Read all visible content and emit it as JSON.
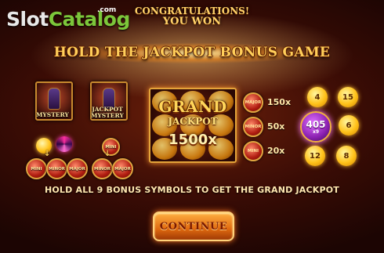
{
  "logo": {
    "part1": "Slot",
    "part2": "Catalog",
    "suffix": ".com"
  },
  "header": {
    "line1": "CONGRATULATIONS!",
    "line2": "YOU WON"
  },
  "headline": "HOLD THE JACKPOT BONUS GAME",
  "mystery_cards": [
    {
      "label": "MYSTERY",
      "icon": "pot-icon"
    },
    {
      "label": "JACKPOT MYSTERY",
      "icon": "pot-icon"
    }
  ],
  "mini_coins": {
    "mini": "MINI",
    "minor": "MINOR",
    "major": "MAJOR"
  },
  "grand": {
    "title": "GRAND",
    "subtitle": "JACKPOT",
    "multiplier": "1500x"
  },
  "paytable": [
    {
      "symbol": "MAJOR",
      "value": "150x"
    },
    {
      "symbol": "MINOR",
      "value": "50x"
    },
    {
      "symbol": "MINI",
      "value": "20x"
    }
  ],
  "multiplier_cluster": {
    "center": "405",
    "center_sub": "x9",
    "surrounding": [
      "4",
      "15",
      "6",
      "8",
      "12"
    ]
  },
  "instruction": "HOLD ALL 9 BONUS SYMBOLS TO GET THE GRAND JACKPOT",
  "continue_label": "CONTINUE",
  "colors": {
    "accent_gold": "#ffcf5a",
    "background": "#3a0c05",
    "button": "#e06a10"
  }
}
